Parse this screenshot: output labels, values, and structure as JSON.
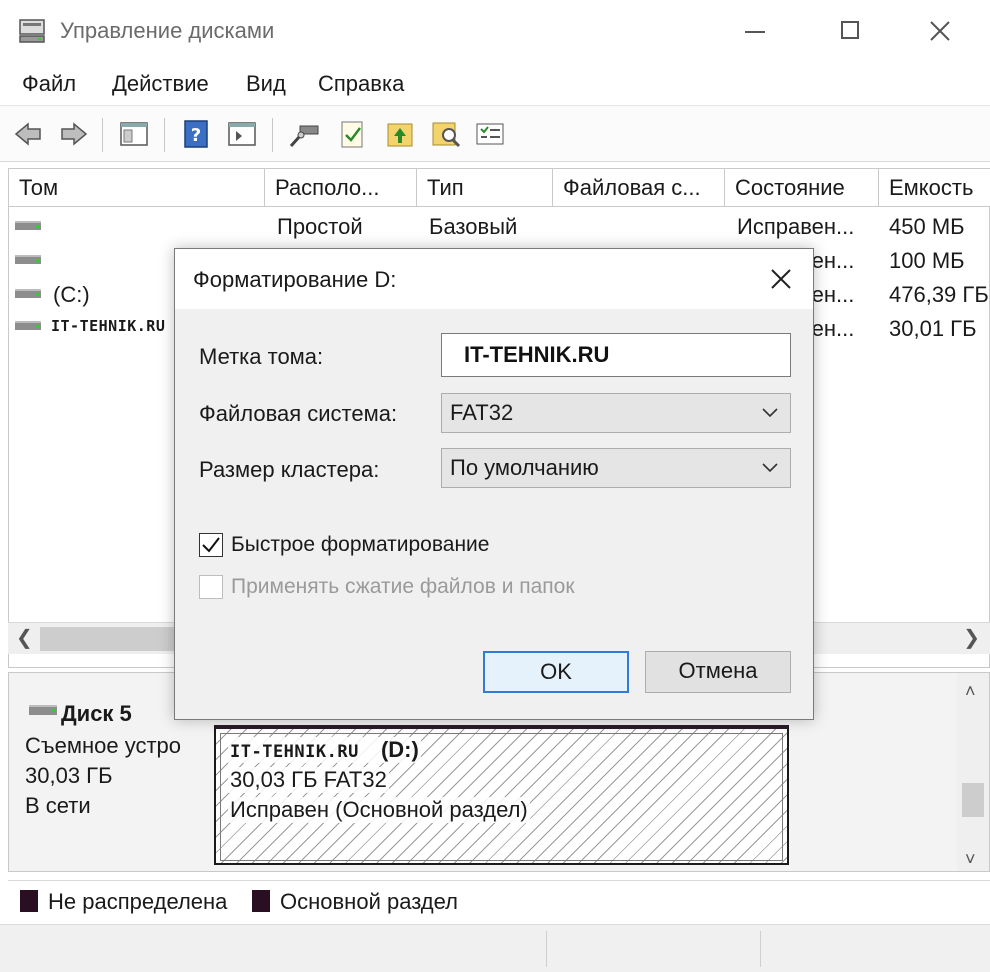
{
  "window": {
    "title": "Управление дисками",
    "icon": "disk-management-icon"
  },
  "menu": [
    "Файл",
    "Действие",
    "Вид",
    "Справка"
  ],
  "toolbar": {
    "buttons": [
      "back-icon",
      "forward-icon",
      "console-tree-icon",
      "help-icon",
      "action-pane-icon",
      "connect-disk-icon",
      "properties-icon",
      "folder-up-icon",
      "folder-search-icon",
      "list-icon"
    ]
  },
  "volume_list": {
    "columns": [
      "Том",
      "Располо...",
      "Тип",
      "Файловая с...",
      "Состояние",
      "Емкость"
    ],
    "rows": [
      {
        "tom": "",
        "layout": "Простой",
        "type": "Базовый",
        "fs": "",
        "status": "Исправен...",
        "capacity": "450 МБ"
      },
      {
        "tom": "",
        "layout": "",
        "type": "",
        "fs": "",
        "status": "Исправен...",
        "capacity": "100 МБ"
      },
      {
        "tom": "(C:)",
        "layout": "",
        "type": "",
        "fs": "",
        "status": "Исправен...",
        "capacity": "476,39 ГБ"
      },
      {
        "tom": "IT-TEHNIK.RU",
        "layout": "",
        "type": "",
        "fs": "",
        "status": "Исправен...",
        "capacity": "30,01 ГБ"
      }
    ]
  },
  "disk_pane": {
    "disk_name": "Диск 5",
    "disk_type": "Съемное устро",
    "disk_size": "30,03 ГБ",
    "disk_state": "В сети",
    "partition": {
      "label": "IT-TEHNIK.RU",
      "letter": "(D:)",
      "size_fs": "30,03 ГБ FAT32",
      "status": "Исправен (Основной раздел)"
    }
  },
  "legend": {
    "unallocated": "Не распределена",
    "primary": "Основной раздел",
    "swatch_color": "#2a0f22"
  },
  "dialog": {
    "title": "Форматирование D:",
    "volume_label_label": "Метка тома:",
    "volume_label_value": "IT-TEHNIK.RU",
    "fs_label": "Файловая система:",
    "fs_value": "FAT32",
    "cluster_label": "Размер кластера:",
    "cluster_value": "По умолчанию",
    "quick_format_label": "Быстрое форматирование",
    "quick_format_checked": true,
    "compression_label": "Применять сжатие файлов и папок",
    "compression_checked": false,
    "ok_label": "OK",
    "cancel_label": "Отмена",
    "accent": "#2f7bd6"
  }
}
